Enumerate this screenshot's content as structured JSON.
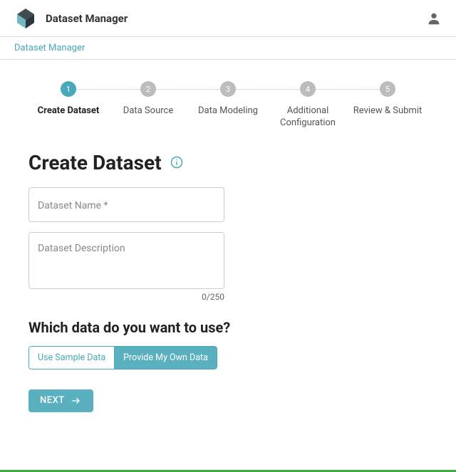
{
  "header": {
    "app_title": "Dataset Manager"
  },
  "breadcrumb": {
    "root": "Dataset Manager"
  },
  "stepper": {
    "steps": [
      {
        "num": "1",
        "label": "Create Dataset",
        "active": true
      },
      {
        "num": "2",
        "label": "Data Source",
        "active": false
      },
      {
        "num": "3",
        "label": "Data Modeling",
        "active": false
      },
      {
        "num": "4",
        "label": "Additional Configuration",
        "active": false
      },
      {
        "num": "5",
        "label": "Review & Submit",
        "active": false
      }
    ]
  },
  "page": {
    "heading": "Create Dataset",
    "name_placeholder": "Dataset Name *",
    "name_value": "",
    "desc_placeholder": "Dataset Description",
    "desc_value": "",
    "char_counter": "0/250",
    "data_question": "Which data do you want to use?",
    "toggle": {
      "sample": "Use Sample Data",
      "own": "Provide My Own Data"
    },
    "next_label": "NEXT"
  },
  "colors": {
    "accent": "#4aa9b8",
    "accent_fill": "#5ab0be",
    "grey_step": "#bcbcbc",
    "progress_green": "#3fae3f"
  }
}
